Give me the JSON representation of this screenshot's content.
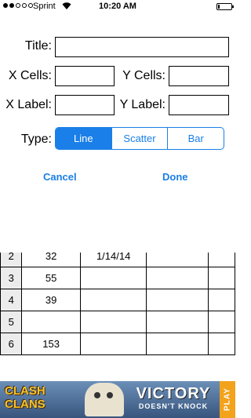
{
  "status_bar": {
    "carrier": "Sprint",
    "time": "10:20 AM"
  },
  "form": {
    "title_label": "Title:",
    "title_value": "",
    "x_cells_label": "X Cells:",
    "x_cells_value": "",
    "y_cells_label": "Y Cells:",
    "y_cells_value": "",
    "x_label_label": "X Label:",
    "x_label_value": "",
    "y_label_label": "Y Label:",
    "y_label_value": "",
    "type_label": "Type:",
    "type_options": [
      "Line",
      "Scatter",
      "Bar"
    ],
    "type_selected": "Line",
    "cancel_label": "Cancel",
    "done_label": "Done"
  },
  "grid": {
    "rows": [
      {
        "num": "2",
        "c1": "32",
        "c2": "1/14/14",
        "c3": "",
        "c4": ""
      },
      {
        "num": "3",
        "c1": "55",
        "c2": "",
        "c3": "",
        "c4": ""
      },
      {
        "num": "4",
        "c1": "39",
        "c2": "",
        "c3": "",
        "c4": ""
      },
      {
        "num": "5",
        "c1": "",
        "c2": "",
        "c3": "",
        "c4": ""
      },
      {
        "num": "6",
        "c1": "153",
        "c2": "",
        "c3": "",
        "c4": ""
      }
    ]
  },
  "ad": {
    "logo_text_1": "CLASH",
    "logo_text_2": "CLANS",
    "headline": "VICTORY",
    "tagline": "DOESN'T KNOCK",
    "play_label": "PLAY"
  },
  "colors": {
    "accent": "#1a7fe8"
  }
}
